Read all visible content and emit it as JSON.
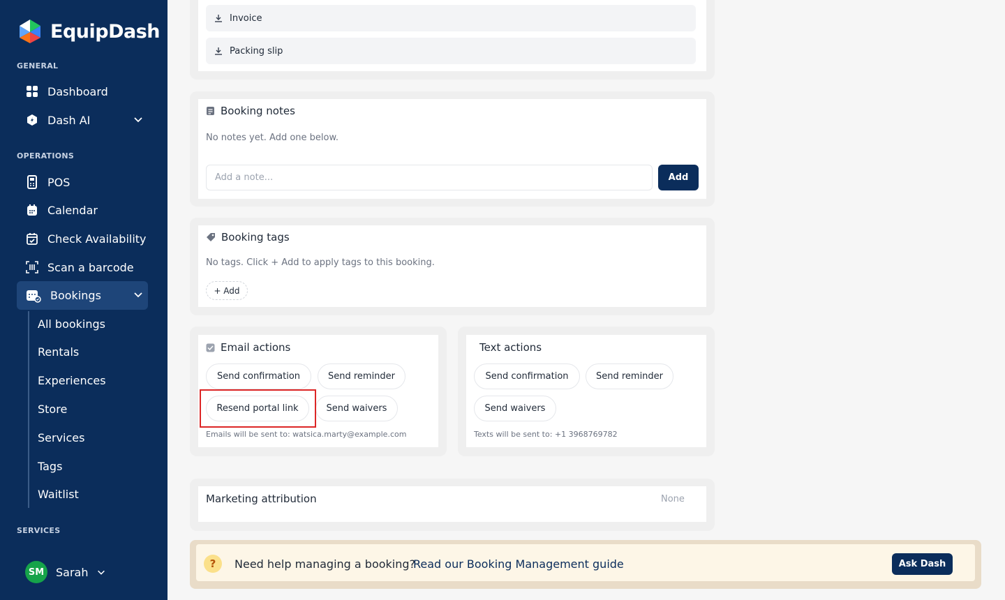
{
  "brand": {
    "name": "EquipDash"
  },
  "sidebar": {
    "general_label": "GENERAL",
    "general_items": [
      {
        "label": "Dashboard",
        "icon": "dashboard-grid-icon"
      },
      {
        "label": "Dash AI",
        "icon": "ai-shield-icon"
      }
    ],
    "operations_label": "OPERATIONS",
    "operations_items": [
      {
        "label": "POS",
        "icon": "pos-terminal-icon"
      },
      {
        "label": "Calendar",
        "icon": "calendar-icon"
      },
      {
        "label": "Check Availability",
        "icon": "calendar-check-icon"
      },
      {
        "label": "Scan a barcode",
        "icon": "barcode-scan-icon"
      },
      {
        "label": "Bookings",
        "icon": "bookings-calendar-icon",
        "active": true
      }
    ],
    "bookings_sub": [
      "All bookings",
      "Rentals",
      "Experiences",
      "Store",
      "Services",
      "Tags",
      "Waitlist"
    ],
    "services_label": "SERVICES",
    "user": {
      "initials": "SM",
      "name": "Sarah",
      "avatar_color": "#16a34a"
    }
  },
  "documents": {
    "items": [
      {
        "label": "Invoice",
        "icon": "download-icon"
      },
      {
        "label": "Packing slip",
        "icon": "download-icon"
      }
    ]
  },
  "booking_notes": {
    "title": "Booking notes",
    "empty_text": "No notes yet. Add one below.",
    "placeholder": "Add a note...",
    "add_label": "Add"
  },
  "booking_tags": {
    "title": "Booking tags",
    "empty_text": "No tags. Click + Add to apply tags to this booking.",
    "add_label": "+ Add"
  },
  "email_actions": {
    "title": "Email actions",
    "buttons": [
      "Send confirmation",
      "Send reminder",
      "Resend portal link",
      "Send waivers"
    ],
    "footer": "Emails will be sent to: watsica.marty@example.com"
  },
  "text_actions": {
    "title": "Text actions",
    "buttons": [
      "Send confirmation",
      "Send reminder",
      "Send waivers"
    ],
    "footer": "Texts will be sent to: +1 3968769782"
  },
  "marketing": {
    "title": "Marketing attribution",
    "value": "None"
  },
  "help": {
    "text": "Need help managing a booking?",
    "link": "Read our Booking Management guide",
    "ask_label": "Ask Dash"
  },
  "colors": {
    "sidebar": "#0b2d5b",
    "accent": "#0b2d5b",
    "highlight": "#dc2626",
    "help_bg": "#fdf6e7"
  }
}
